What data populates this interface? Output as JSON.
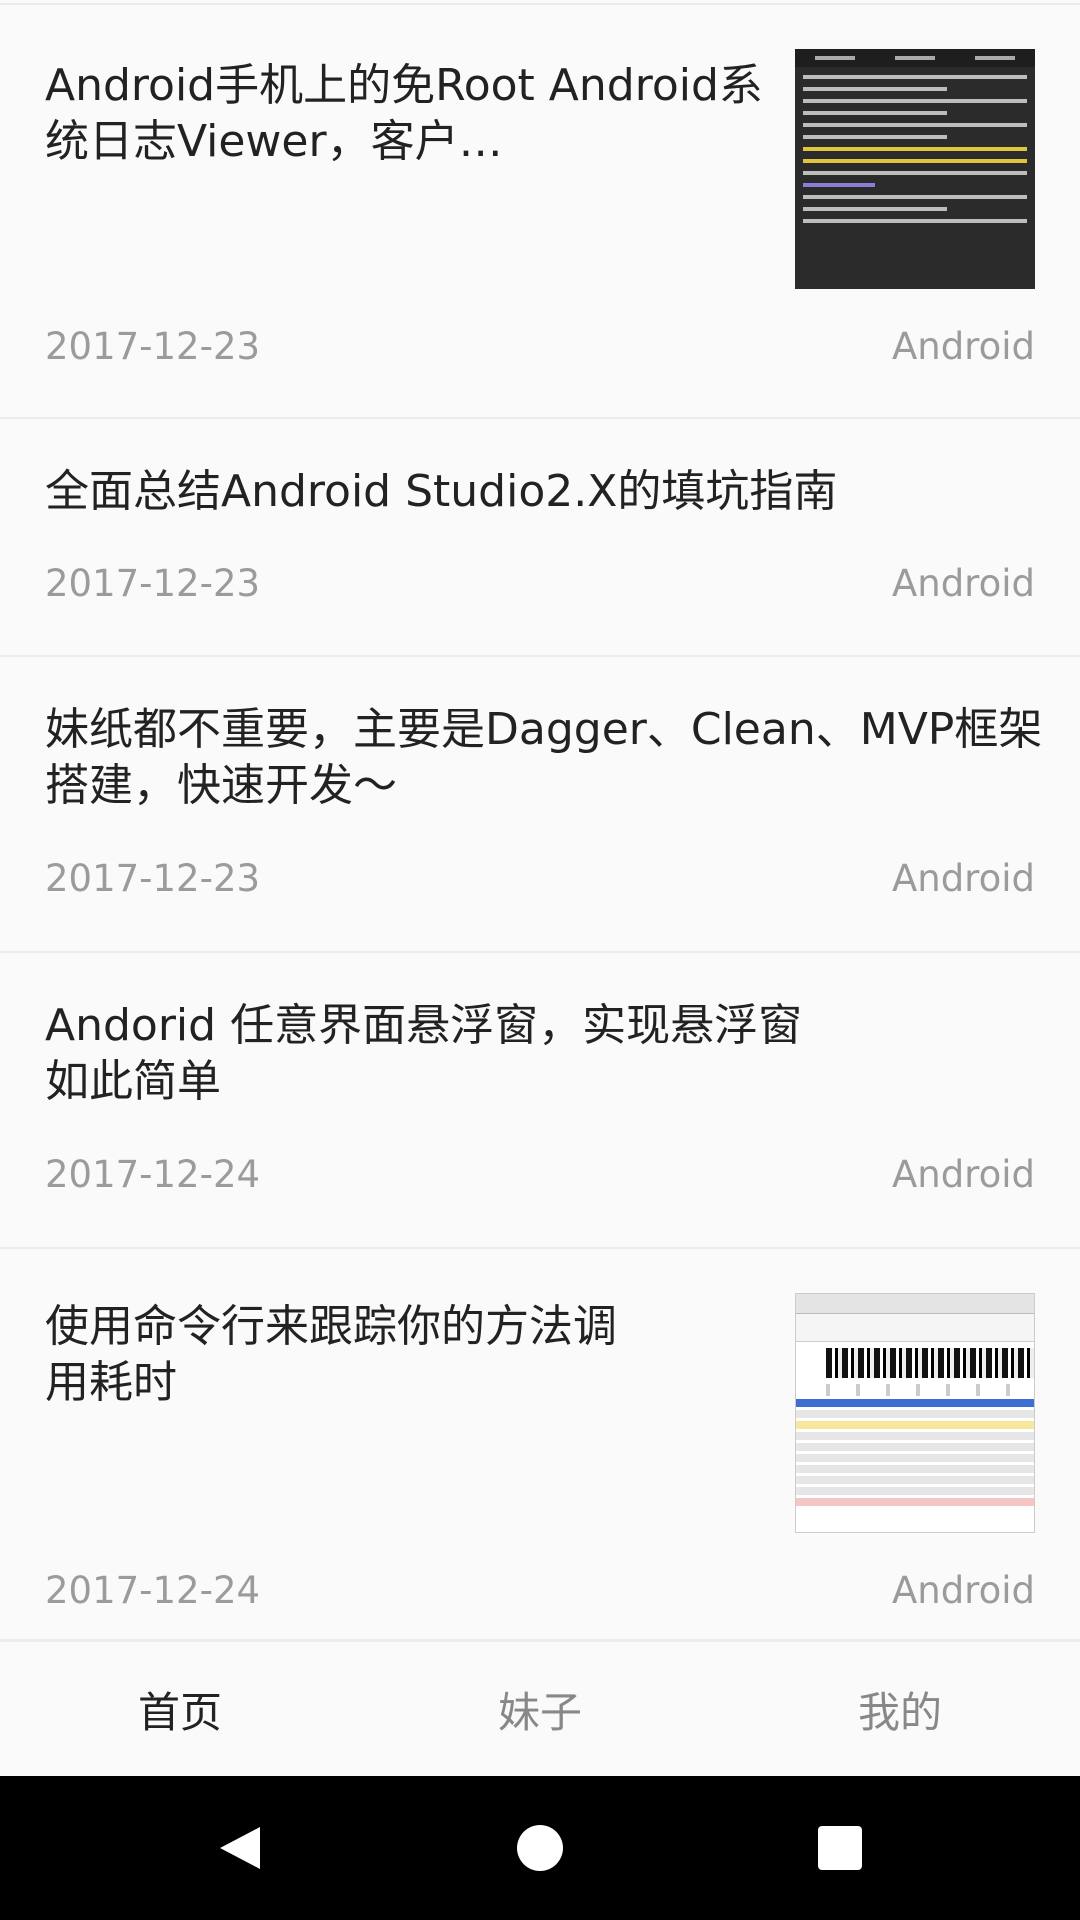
{
  "articles": [
    {
      "title": "Android手机上的免Root Android系统日志Viewer，客户…",
      "date": "2017-12-23",
      "category": "Android",
      "has_thumbnail": true,
      "thumbnail": "log-viewer-screenshot"
    },
    {
      "title": "全面总结Android Studio2.X的填坑指南",
      "date": "2017-12-23",
      "category": "Android",
      "has_thumbnail": false
    },
    {
      "title": "妹纸都不重要，主要是Dagger、Clean、MVP框架搭建，快速开发～",
      "date": "2017-12-23",
      "category": "Android",
      "has_thumbnail": false
    },
    {
      "title": "Andorid 任意界面悬浮窗，实现悬浮窗如此简单",
      "date": "2017-12-24",
      "category": "Android",
      "has_thumbnail": false
    },
    {
      "title": "使用命令行来跟踪你的方法调用耗时",
      "date": "2017-12-24",
      "category": "Android",
      "has_thumbnail": true,
      "thumbnail": "method-trace-screenshot"
    }
  ],
  "tabs": [
    {
      "label": "首页",
      "active": true
    },
    {
      "label": "妹子",
      "active": false
    },
    {
      "label": "我的",
      "active": false
    }
  ],
  "navbar": {
    "icons": [
      "back-icon",
      "home-icon",
      "recents-icon"
    ]
  },
  "colors": {
    "background": "#fafafa",
    "title_text": "#222222",
    "meta_text": "#9b9b9b",
    "divider": "#ececec",
    "tab_inactive": "#888888",
    "navbar": "#000000"
  }
}
